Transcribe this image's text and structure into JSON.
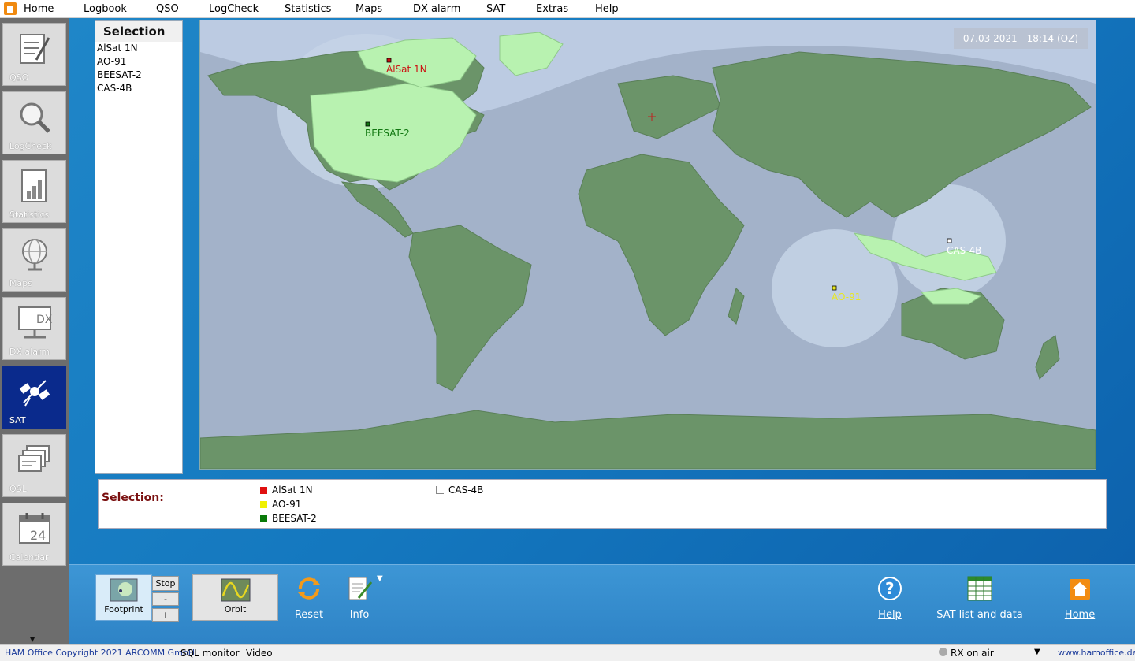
{
  "menu": {
    "items": [
      "Home",
      "Logbook",
      "QSO",
      "LogCheck",
      "Statistics",
      "Maps",
      "DX alarm",
      "SAT",
      "Extras",
      "Help"
    ]
  },
  "sidebar": {
    "items": [
      {
        "label": "QSO",
        "icon": "notepad-icon"
      },
      {
        "label": "LogCheck",
        "icon": "magnifier-icon"
      },
      {
        "label": "Statistics",
        "icon": "bar-chart-icon"
      },
      {
        "label": "Maps",
        "icon": "globe-icon"
      },
      {
        "label": "DX alarm",
        "icon": "dx-monitor-icon"
      },
      {
        "label": "SAT",
        "icon": "satellite-icon",
        "active": true
      },
      {
        "label": "QSL",
        "icon": "qsl-cards-icon"
      },
      {
        "label": "Calendar",
        "icon": "calendar-icon",
        "badge": "24"
      }
    ]
  },
  "selection": {
    "header": "Selection",
    "items": [
      "AlSat 1N",
      "AO-91",
      "BEESAT-2",
      "CAS-4B"
    ]
  },
  "map": {
    "timestamp": "07.03 2021 - 18:14 (OZ)",
    "satellites": [
      {
        "name": "AlSat 1N",
        "color": "#cc1111"
      },
      {
        "name": "BEESAT-2",
        "color": "#117711"
      },
      {
        "name": "AO-91",
        "color": "#e8e820"
      },
      {
        "name": "CAS-4B",
        "color": "#ffffff"
      }
    ]
  },
  "legend": {
    "title": "Selection:",
    "entries": [
      {
        "name": "AlSat 1N",
        "color": "#e01010"
      },
      {
        "name": "AO-91",
        "color": "#f0f000"
      },
      {
        "name": "BEESAT-2",
        "color": "#0a7a0a"
      },
      {
        "name": "CAS-4B",
        "color": "#ffffff"
      }
    ]
  },
  "toolbar": {
    "footprint": "Footprint",
    "stop": "Stop",
    "minus": "-",
    "plus": "+",
    "orbit": "Orbit",
    "reset": "Reset",
    "info": "Info",
    "help": "Help",
    "satlist": "SAT list and data",
    "home": "Home"
  },
  "status": {
    "copyright": "HAM Office Copyright 2021 ARCOMM GmbH",
    "sql": "SQL monitor",
    "video": "Video",
    "rx": "RX on air",
    "url": "www.hamoffice.de"
  }
}
